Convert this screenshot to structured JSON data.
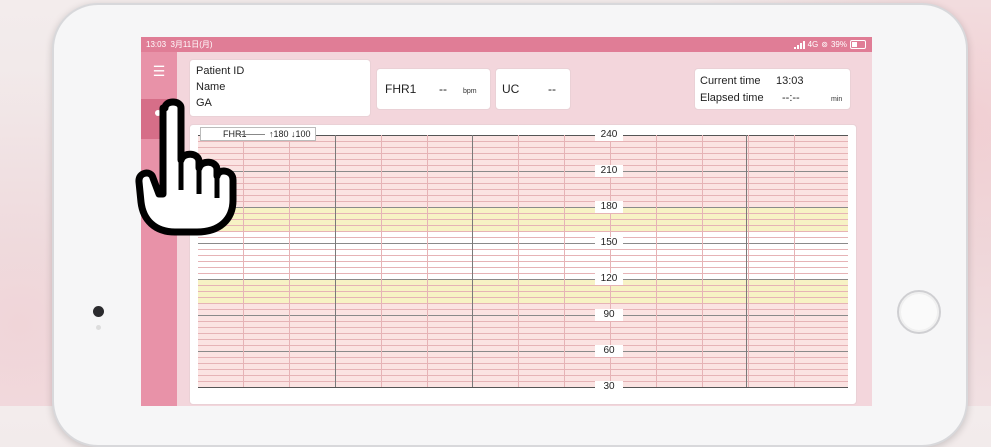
{
  "status_bar": {
    "time": "13:03",
    "date": "3月11日(月)",
    "network": "4G",
    "battery": "39%"
  },
  "sidebar": {
    "menu_icon": "menu-icon",
    "active_icon": "person-icon"
  },
  "patient_card": {
    "patient_id_label": "Patient ID",
    "name_label": "Name",
    "ga_label": "GA"
  },
  "fhr_card": {
    "label": "FHR1",
    "value": "--",
    "unit": "bpm"
  },
  "uc_card": {
    "label": "UC",
    "value": "--"
  },
  "time_card": {
    "current_label": "Current time",
    "current_value": "13:03",
    "elapsed_label": "Elapsed time",
    "elapsed_value": "--:--",
    "elapsed_unit": "min"
  },
  "chart": {
    "legend": {
      "series": "FHR1",
      "alarm": "↑180 ↓100"
    },
    "y_axis": {
      "ticks": [
        "240",
        "210",
        "180",
        "150",
        "120",
        "90",
        "60",
        "30"
      ],
      "min": 30,
      "max": 240
    },
    "highlight_bands": [
      {
        "from": 180,
        "to": 160,
        "color": "#f7f2c4"
      },
      {
        "from": 120,
        "to": 100,
        "color": "#f7f2c4"
      }
    ],
    "normal_band": {
      "from": 160,
      "to": 120,
      "color": "#ffffff"
    },
    "background_color": "#fbe3e2",
    "gridline_color": "#e6b3b6",
    "axis_color": "#555555"
  },
  "colors": {
    "status_bar": "#e07d96",
    "sidebar": "#e892a8",
    "sidebar_active": "#d66e88",
    "accent": "#d66e88"
  }
}
